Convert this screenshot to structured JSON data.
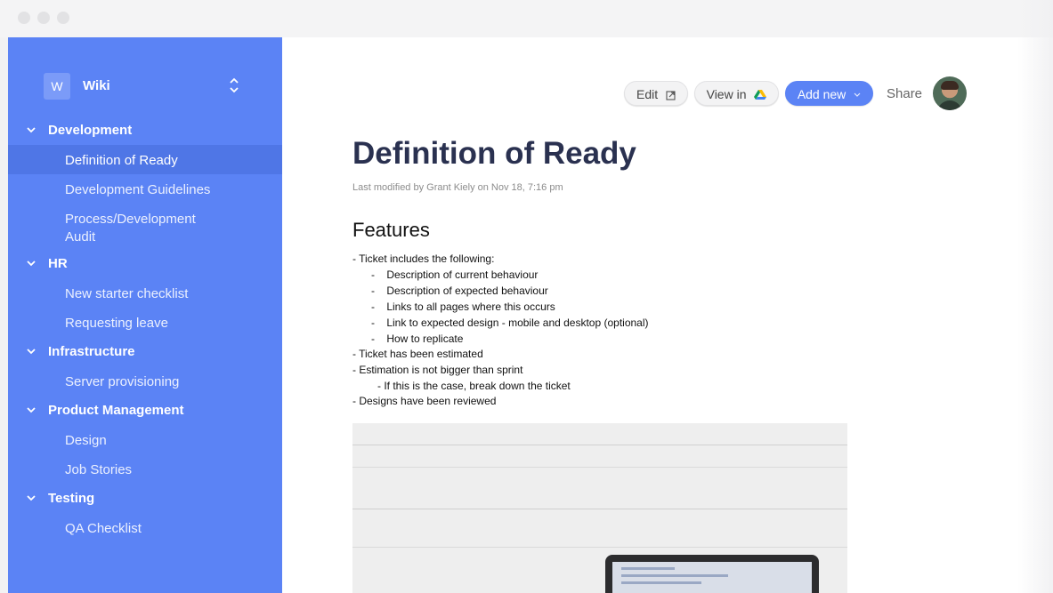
{
  "workspace": {
    "badge": "W",
    "name": "Wiki"
  },
  "sidebar": {
    "sections": [
      {
        "label": "Development",
        "items": [
          "Definition of Ready",
          "Development Guidelines",
          "Process/Development Audit"
        ]
      },
      {
        "label": "HR",
        "items": [
          "New starter checklist",
          "Requesting leave"
        ]
      },
      {
        "label": "Infrastructure",
        "items": [
          "Server provisioning"
        ]
      },
      {
        "label": "Product Management",
        "items": [
          "Design",
          "Job Stories"
        ]
      },
      {
        "label": "Testing",
        "items": [
          "QA Checklist"
        ]
      }
    ],
    "active_item": "Definition of Ready"
  },
  "toolbar": {
    "edit_label": "Edit",
    "view_in_label": "View in",
    "add_new_label": "Add new",
    "share_label": "Share"
  },
  "document": {
    "title": "Definition of Ready",
    "meta": "Last modified by Grant Kiely on Nov 18, 7:16 pm",
    "heading": "Features",
    "lines": [
      "- Ticket includes the following:",
      "-    Description of current behaviour",
      "-    Description of expected behaviour",
      "-    Links to all pages where this occurs",
      "-    Link to expected design - mobile and desktop (optional)",
      "-    How to replicate",
      "- Ticket has been estimated",
      "- Estimation is not bigger than sprint",
      "- If this is the case, break down the ticket",
      "- Designs have been reviewed"
    ]
  },
  "colors": {
    "sidebar_bg": "#5b83f5",
    "sidebar_active": "#4f76e6",
    "title_color": "#2a3150",
    "accent": "#5b83f5"
  },
  "icons": {
    "edit": "external-link-icon",
    "view_in": "google-drive-icon",
    "add_new": "caret-down-icon",
    "workspace_toggle": "up-down-chevron-icon",
    "section": "chevron-down-icon"
  }
}
